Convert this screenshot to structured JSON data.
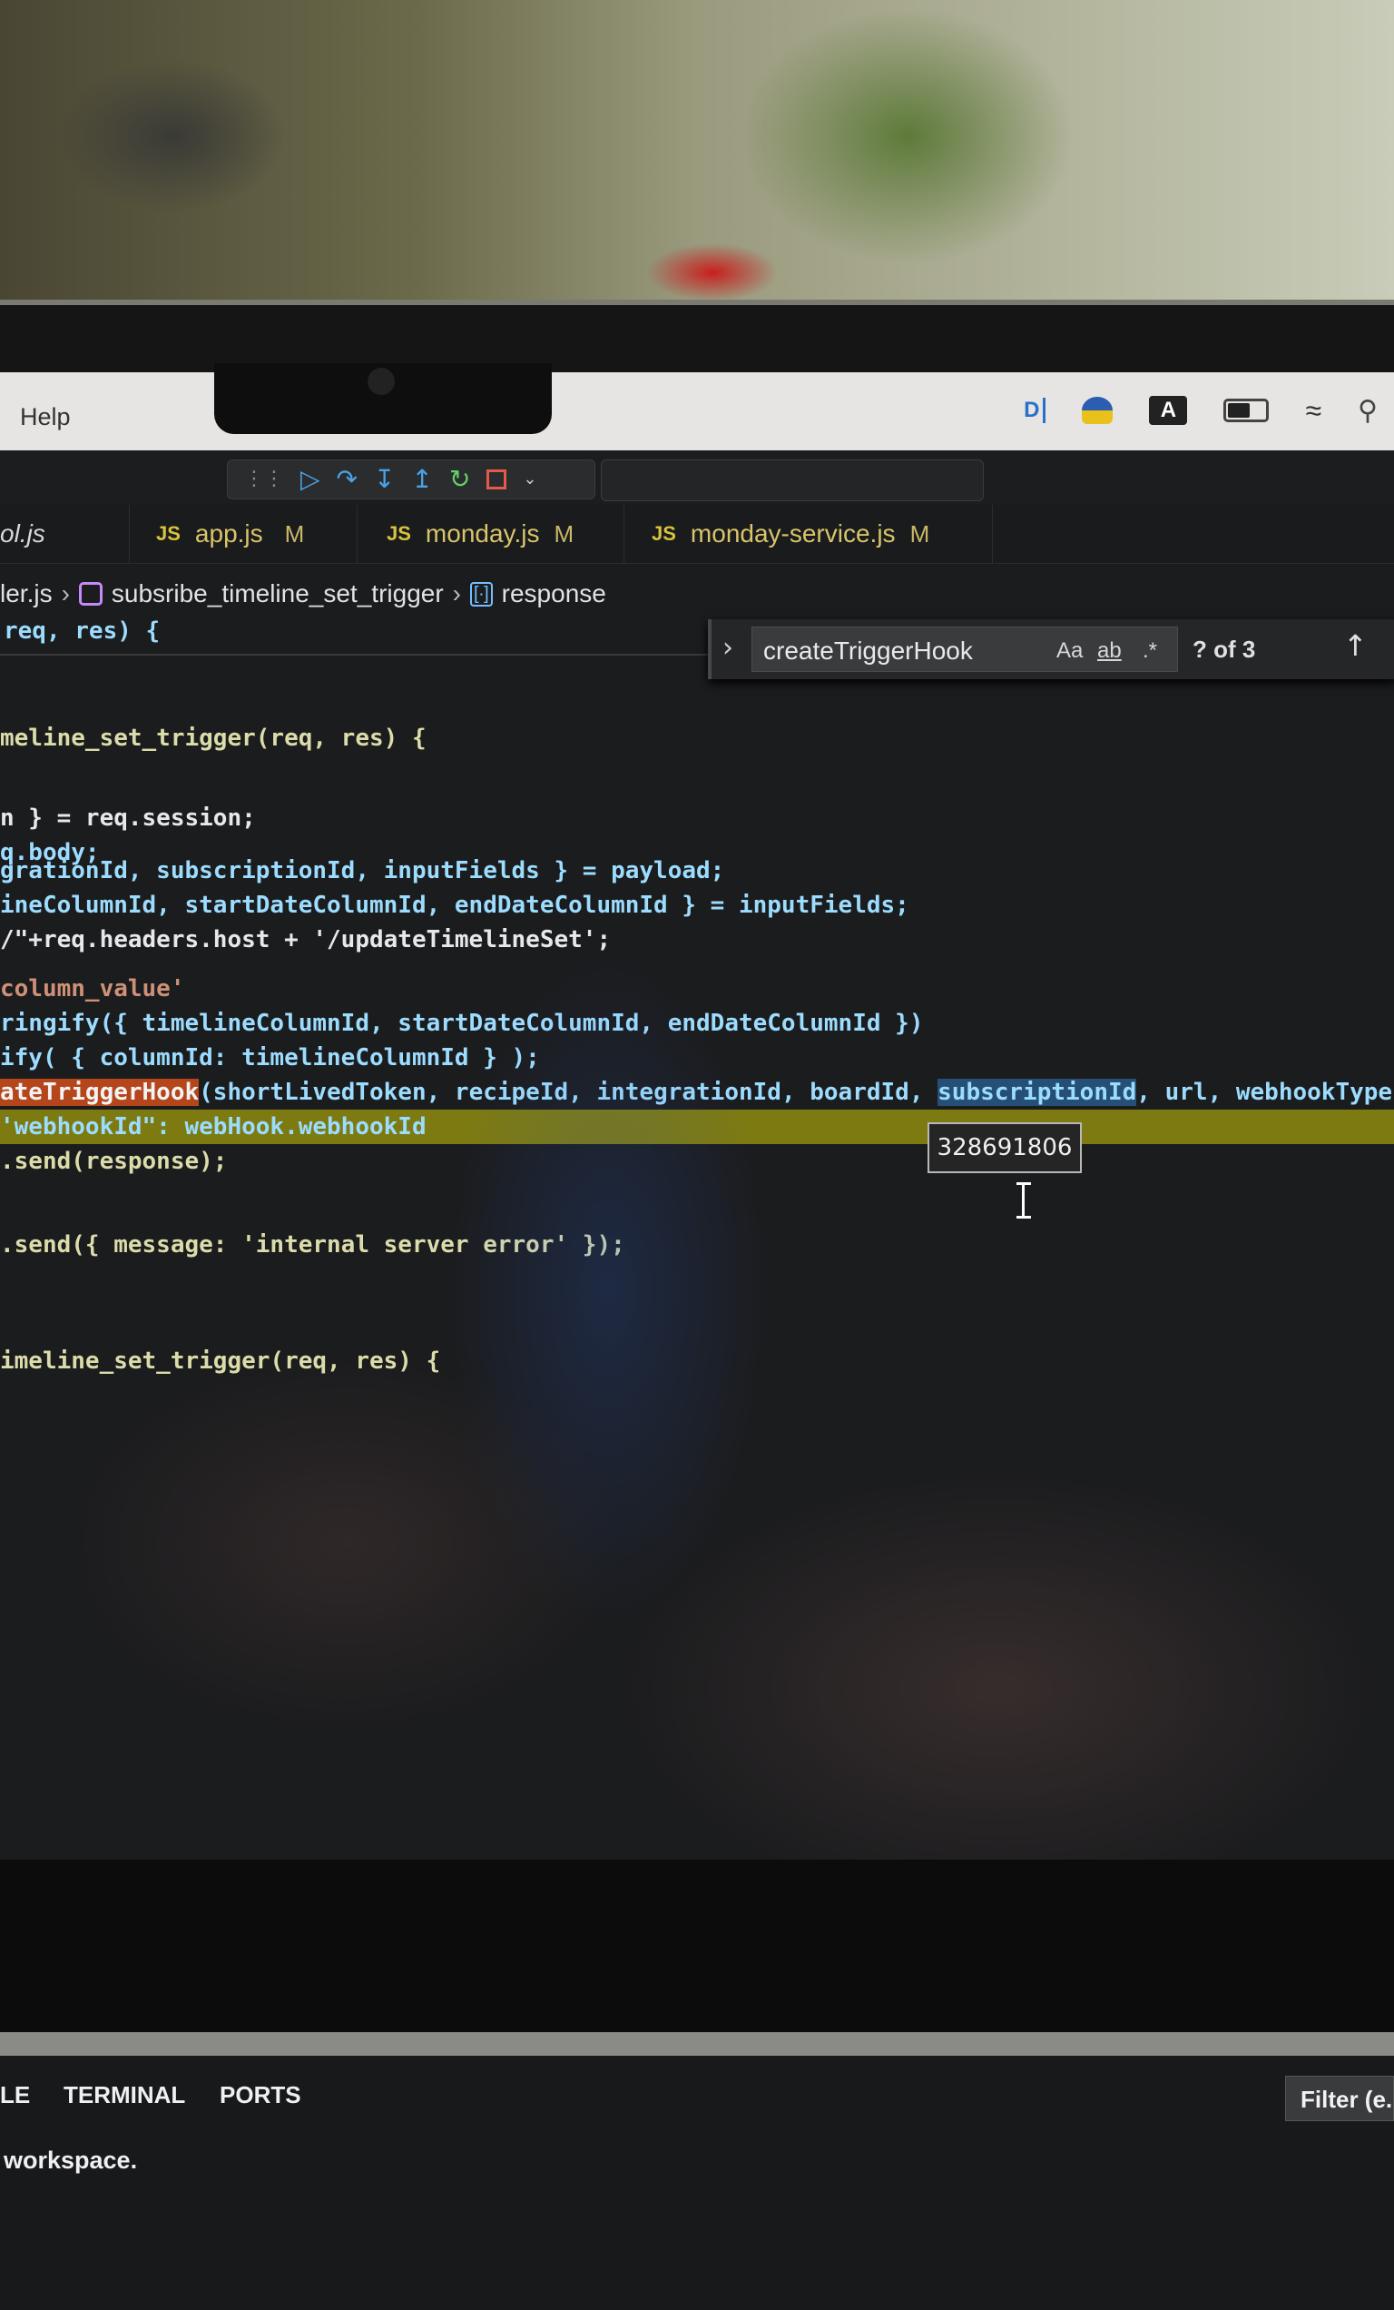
{
  "menubar": {
    "help": "Help"
  },
  "tabs": [
    {
      "name": "ol.js",
      "modified": ""
    },
    {
      "name": "app.js",
      "modified": "M"
    },
    {
      "name": "monday.js",
      "modified": "M"
    },
    {
      "name": "monday-service.js",
      "modified": "M"
    }
  ],
  "tab_file_badge": "JS",
  "breadcrumb": {
    "file": "ler.js",
    "function": "subsribe_timeline_set_trigger",
    "variable": "response"
  },
  "find": {
    "query": "createTriggerHook",
    "match_case": "Aa",
    "whole_word": "ab",
    "regex": ".*",
    "count": "? of 3"
  },
  "hover": {
    "value": "328691806"
  },
  "panel": {
    "tabs": [
      "LE",
      "TERMINAL",
      "PORTS"
    ],
    "filter_placeholder": "Filter (e.",
    "message": "workspace."
  },
  "code_lines": {
    "sticky": "req, res) {",
    "l1": "meline_set_trigger(req, res) {",
    "l2": "n } = req.session;",
    "l3": "q.body;",
    "l4": "grationId, subscriptionId, inputFields } = payload;",
    "l5": "ineColumnId, startDateColumnId, endDateColumnId } = inputFields;",
    "l6": "/\"+req.headers.host + '/updateTimelineSet';",
    "l7": "column_value'",
    "l8": "ringify({ timelineColumnId, startDateColumnId, endDateColumnId })",
    "l9": "ify( { columnId: timelineColumnId } );",
    "l10a": "ateTriggerHook",
    "l10b": "(shortLivedToken, recipeId, integrationId, boardId, ",
    "l10c": "subscriptionId",
    "l10d": ", url, webhookType",
    "l11": "'webhookId\": webHook.webhookId",
    "l12": ".send(response);",
    "l13": ".send({ message: 'internal server error' });",
    "l14": "imeline_set_trigger(req, res) {"
  }
}
